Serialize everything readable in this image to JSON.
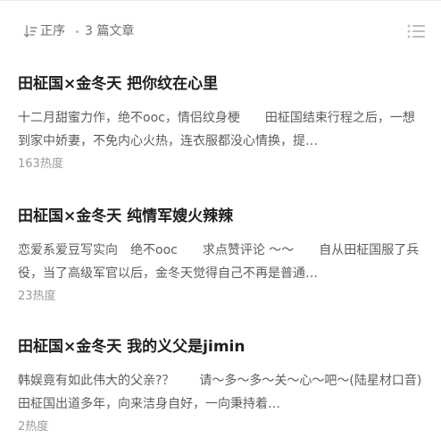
{
  "toolbar": {
    "sort_label": "正序",
    "article_count": "3 篇文章",
    "sort_icon": "sort-ascending-icon",
    "list_icon": "list-view-icon"
  },
  "articles": [
    {
      "title": "田柾国×金冬天 把你纹在心里",
      "excerpt": "十二月甜蜜力作，绝不ooc，情侣纹身梗　　田柾国结束行程之后，一想到家中娇妻，不免内心火热，连衣服都没心情换，提…",
      "heat": "163热度"
    },
    {
      "title": "田柾国×金冬天 纯情军嫂火辣辣",
      "excerpt": "恋爱系爱豆写实向　绝不ooc　　求点赞评论 ～～　　自从田柾国服了兵役，当了高级军官以后，金冬天觉得自己不再是普通…",
      "heat": "23热度"
    },
    {
      "title": "田柾国×金冬天 我的义父是jimin",
      "excerpt": "韩娱竟有如此伟大的父亲?？　　请～多～多～关～心～吧～(陆星材口音)　　田柾国出道多年，向来洁身自好，一向秉持着…",
      "heat": "2热度"
    }
  ],
  "colors": {
    "title": "#1f1f1f",
    "excerpt": "#5c5c5c",
    "meta": "#9a9a9a",
    "toolbar_text": "#6f6f6f"
  }
}
